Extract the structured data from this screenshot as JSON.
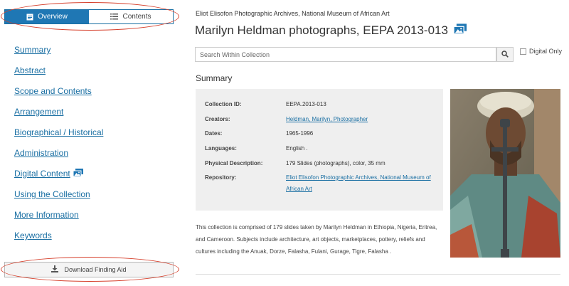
{
  "tabs": {
    "overview": "Overview",
    "contents": "Contents"
  },
  "nav": [
    {
      "label": "Summary"
    },
    {
      "label": "Abstract"
    },
    {
      "label": "Scope and Contents"
    },
    {
      "label": "Arrangement"
    },
    {
      "label": "Biographical / Historical"
    },
    {
      "label": "Administration"
    },
    {
      "label": "Digital Content",
      "icon": "images-icon"
    },
    {
      "label": "Using the Collection"
    },
    {
      "label": "More Information"
    },
    {
      "label": "Keywords"
    }
  ],
  "download": {
    "label": "Download Finding Aid",
    "icon": "download-icon"
  },
  "breadcrumb": "Eliot Elisofon Photographic Archives, National Museum of African Art",
  "title": "Marilyn Heldman photographs, EEPA 2013-013",
  "title_icon": "images-icon",
  "search": {
    "placeholder": "Search Within Collection",
    "button_icon": "search-icon",
    "digital_only_label": "Digital Only",
    "digital_only_checked": false
  },
  "summary": {
    "heading": "Summary",
    "rows": [
      {
        "label": "Collection ID:",
        "value": "EEPA.2013-013",
        "link": false
      },
      {
        "label": "Creators:",
        "value": "Heldman, Marilyn, Photographer",
        "link": true
      },
      {
        "label": "Dates:",
        "value": "1965-1996",
        "link": false
      },
      {
        "label": "Languages:",
        "value": "English .",
        "link": false
      },
      {
        "label": "Physical Description:",
        "value": "179 Slides (photographs), color, 35 mm",
        "link": false
      },
      {
        "label": "Repository:",
        "value": "Eliot Elisofon Photographic Archives, National Museum of African Art",
        "link": true
      }
    ],
    "description": "This collection is comprised of 179 slides taken by Marilyn Heldman in Ethiopia, Nigeria, Eritrea, and Cameroon. Subjects include architecture, art objects, marketplaces, pottery, reliefs and cultures including the Anuak, Dorze, Falasha, Fulani, Gurage, Tigre, Falasha ."
  },
  "colors": {
    "accent": "#1f77b4",
    "link": "#1a6fa3",
    "annotation": "#d6402c",
    "summary_bg": "#efefef"
  }
}
